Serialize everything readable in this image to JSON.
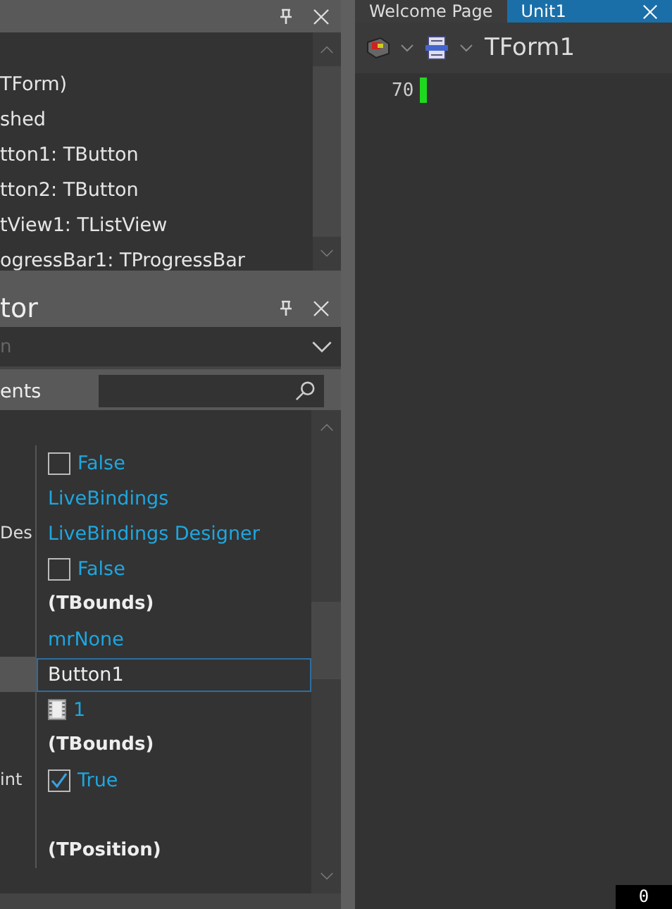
{
  "structure": {
    "items": [
      {
        "label": "TForm)"
      },
      {
        "label": "shed"
      },
      {
        "label": "tton1: TButton"
      },
      {
        "label": "tton2: TButton"
      },
      {
        "label": "tView1: TListView"
      },
      {
        "label": "ogressBar1: TProgressBar"
      }
    ]
  },
  "inspector": {
    "title": "tor",
    "combo": {
      "value": "n"
    },
    "tab": "ents",
    "rows": [
      {
        "kind": "check",
        "checked": false,
        "value": "False"
      },
      {
        "kind": "link",
        "value": "LiveBindings"
      },
      {
        "kind": "link",
        "name": "Des",
        "value": "LiveBindings Designer"
      },
      {
        "kind": "check",
        "checked": false,
        "value": "False"
      },
      {
        "kind": "bold",
        "value": "(TBounds)"
      },
      {
        "kind": "link",
        "value": "mrNone"
      },
      {
        "kind": "edit",
        "selected": true,
        "value": "Button1"
      },
      {
        "kind": "image",
        "value": "1"
      },
      {
        "kind": "bold",
        "value": "(TBounds)"
      },
      {
        "kind": "check",
        "checked": true,
        "name": "int",
        "value": "True"
      },
      {
        "kind": "empty"
      },
      {
        "kind": "bold",
        "value": "(TPosition)"
      }
    ]
  },
  "editor": {
    "tabs": [
      {
        "label": "Welcome Page",
        "selected": false
      },
      {
        "label": "Unit1",
        "selected": true
      }
    ],
    "form": "TForm1",
    "line_number": "70"
  },
  "counter": "0"
}
